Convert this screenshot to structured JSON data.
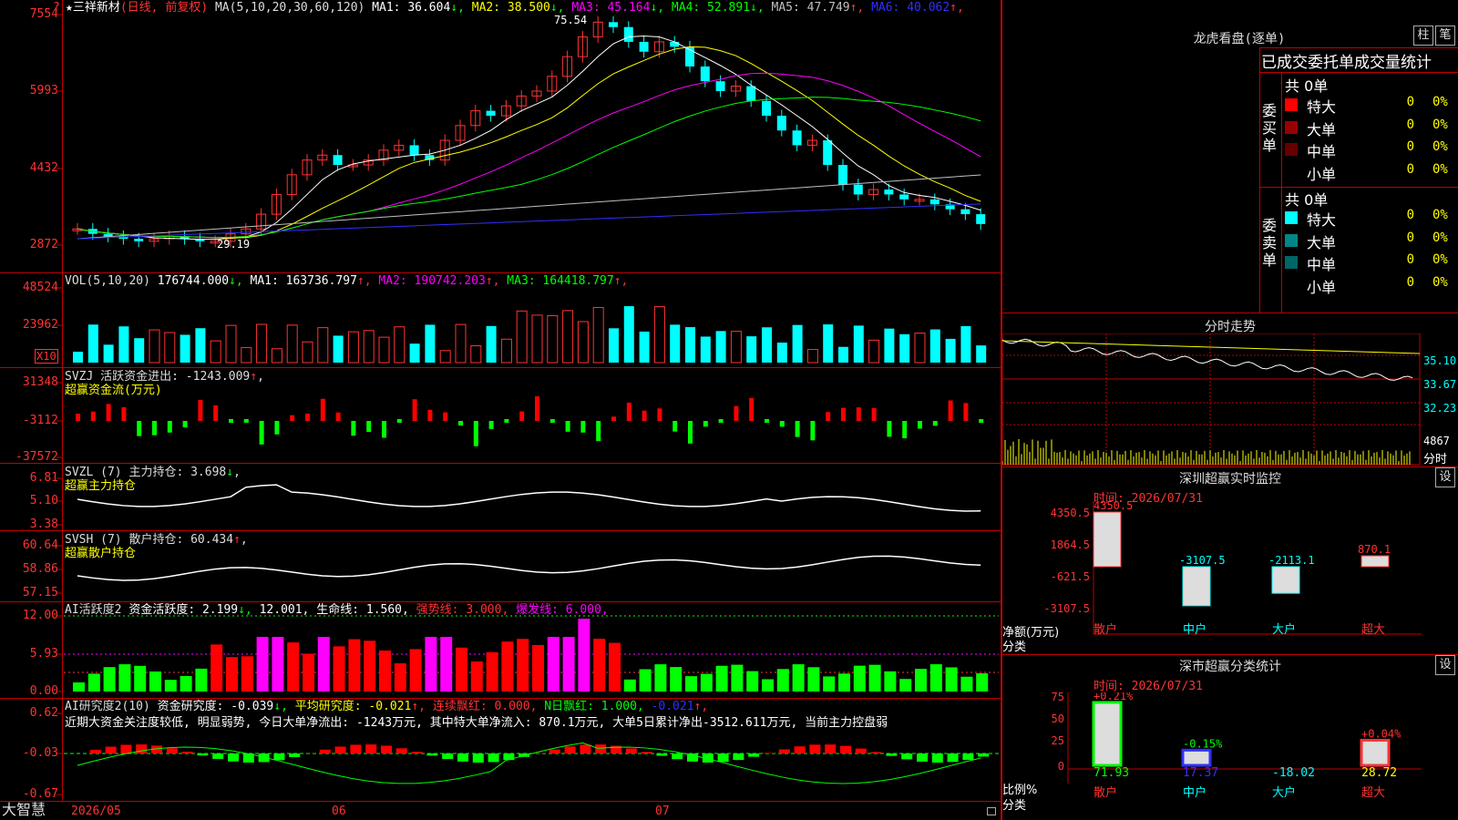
{
  "stock": {
    "name": "三祥新材",
    "mode": "(日线, 前复权)",
    "star": "★",
    "marker": "?"
  },
  "ma": {
    "header": "MA(5,10,20,30,60,120)",
    "items": [
      {
        "label": "MA1: 36.604",
        "arrow": "↓",
        "color": "#ffffff"
      },
      {
        "label": "MA2: 38.500",
        "arrow": "↓",
        "color": "#ffff00"
      },
      {
        "label": "MA3: 45.164",
        "arrow": "↓",
        "color": "#ff00ff"
      },
      {
        "label": "MA4: 52.891",
        "arrow": "↓",
        "color": "#00ff00"
      },
      {
        "label": "MA5: 47.749",
        "arrow": "↑",
        "color": "#c0c0c0"
      },
      {
        "label": "MA6: 40.062",
        "arrow": "↑",
        "color": "#3030ff"
      }
    ],
    "high_label": "75.54",
    "low_label": "29.19"
  },
  "price_axis": [
    "7554",
    "5993",
    "4432",
    "2872"
  ],
  "vol": {
    "header": "VOL(5,10,20)",
    "value": "176744.000",
    "items": [
      {
        "label": "MA1: 163736.797",
        "arrow": "↑",
        "color": "#ffffff"
      },
      {
        "label": "MA2: 190742.203",
        "arrow": "↑",
        "color": "#ff00ff"
      },
      {
        "label": "MA3: 164418.797",
        "arrow": "↑",
        "color": "#00ff00"
      }
    ],
    "axis": [
      "48524",
      "23962"
    ],
    "unit": "X10"
  },
  "svzj": {
    "header": "SVZJ",
    "title": "活跃资金进出: -1243.009",
    "arrow": "↑",
    "sub": "超赢资金流(万元)",
    "axis": [
      "31348",
      "-3112",
      "-37572"
    ]
  },
  "svzl": {
    "header": "SVZL (7)",
    "title": "主力持仓: 3.698",
    "arrow": "↓",
    "sub": "超赢主力持仓",
    "axis": [
      "6.81",
      "5.10",
      "3.38"
    ]
  },
  "svsh": {
    "header": "SVSH (7)",
    "title": "散户持仓: 60.434",
    "arrow": "↑",
    "sub": "超赢散户持仓",
    "axis": [
      "60.64",
      "58.86",
      "57.15"
    ]
  },
  "ai2": {
    "header": "AI活跃度2",
    "items": [
      {
        "label": "资金活跃度: 2.199",
        "arrow": "↓",
        "color": "#ffffff"
      },
      {
        "label": "12.001,",
        "arrow": "",
        "color": "#ffffff"
      },
      {
        "label": "生命线: 1.560,",
        "arrow": "",
        "color": "#ffffff"
      },
      {
        "label": "强势线: 3.000,",
        "arrow": "",
        "color": "#ff3333"
      },
      {
        "label": "爆发线: 6.000,",
        "arrow": "",
        "color": "#ff00ff"
      }
    ],
    "axis": [
      "12.00",
      "5.93",
      "0.00"
    ]
  },
  "ai10": {
    "header": "AI研究度2(10)",
    "items": [
      {
        "label": "资金研究度: -0.039",
        "arrow": "↓",
        "color": "#ffffff"
      },
      {
        "label": "平均研究度: -0.021",
        "arrow": "↑",
        "color": "#ffff00"
      },
      {
        "label": "连续飘红: 0.000,",
        "arrow": "",
        "color": "#ff3333"
      },
      {
        "label": "N日飘红: 1.000,",
        "arrow": "",
        "color": "#00ff00"
      },
      {
        "label": "-0.021",
        "arrow": "↑",
        "color": "#3030ff"
      }
    ],
    "note": "近期大资金关注度较低, 明显弱势, 今日大单净流出: -1243万元, 其中特大单净流入: 870.1万元, 大单5日累计净出-3512.611万元, 当前主力控盘弱",
    "axis": [
      "0.62",
      "-0.03",
      "-0.67"
    ]
  },
  "dates": {
    "brand": "大智慧",
    "d1": "2026/05",
    "d2": "06",
    "d3": "07"
  },
  "dragon": {
    "title": "龙虎看盘(逐单)",
    "btn1": "柱",
    "btn2": "笔",
    "heading": "已成交委托单成交量统计",
    "buy_label": "委买单",
    "sell_label": "委卖单",
    "buy_total": "共 0单",
    "sell_total": "共 0单",
    "buy_rows": [
      {
        "name": "特大",
        "count": "0",
        "pct": "0%",
        "color": "#ff0000"
      },
      {
        "name": "大单",
        "count": "0",
        "pct": "0%",
        "color": "#990000"
      },
      {
        "name": "中单",
        "count": "0",
        "pct": "0%",
        "color": "#660000"
      },
      {
        "name": "小单",
        "count": "0",
        "pct": "0%",
        "color": "#000000"
      }
    ],
    "sell_rows": [
      {
        "name": "特大",
        "count": "0",
        "pct": "0%",
        "color": "#00ffff"
      },
      {
        "name": "大单",
        "count": "0",
        "pct": "0%",
        "color": "#008888"
      },
      {
        "name": "中单",
        "count": "0",
        "pct": "0%",
        "color": "#006666"
      },
      {
        "name": "小单",
        "count": "0",
        "pct": "0%",
        "color": "#000000"
      }
    ]
  },
  "intraday": {
    "title": "分时走势",
    "axis": [
      "35.10",
      "33.67",
      "32.23"
    ],
    "vol_value": "4867",
    "vol_label": "分时"
  },
  "sz_monitor": {
    "title": "深圳超赢实时监控",
    "btn": "设",
    "time": "时间: 2026/07/31",
    "axis": [
      "4350.5",
      "1864.5",
      "-621.5",
      "-3107.5"
    ],
    "ylabel": "净额(万元)",
    "xlabel": "分类",
    "bars": [
      {
        "cat": "散户",
        "value": "4350.5",
        "num": 4350.5
      },
      {
        "cat": "中户",
        "value": "-3107.5",
        "num": -3107.5
      },
      {
        "cat": "大户",
        "value": "-2113.1",
        "num": -2113.1
      },
      {
        "cat": "超大",
        "value": "870.1",
        "num": 870.1
      }
    ]
  },
  "sz_class": {
    "title": "深市超赢分类统计",
    "btn": "设",
    "time": "时间: 2026/07/31",
    "axis": [
      "75",
      "50",
      "25",
      "0"
    ],
    "ylabel": "比例%",
    "xlabel": "分类",
    "bars": [
      {
        "cat": "散户",
        "top": "+0.21%",
        "value": "71.93",
        "num": 71.93
      },
      {
        "cat": "中户",
        "top": "-0.15%",
        "value": "17.37",
        "num": 17.37
      },
      {
        "cat": "大户",
        "top": "",
        "value": "-18.02",
        "num": -18.02
      },
      {
        "cat": "超大",
        "top": "+0.04%",
        "value": "28.72",
        "num": 28.72
      }
    ]
  }
}
